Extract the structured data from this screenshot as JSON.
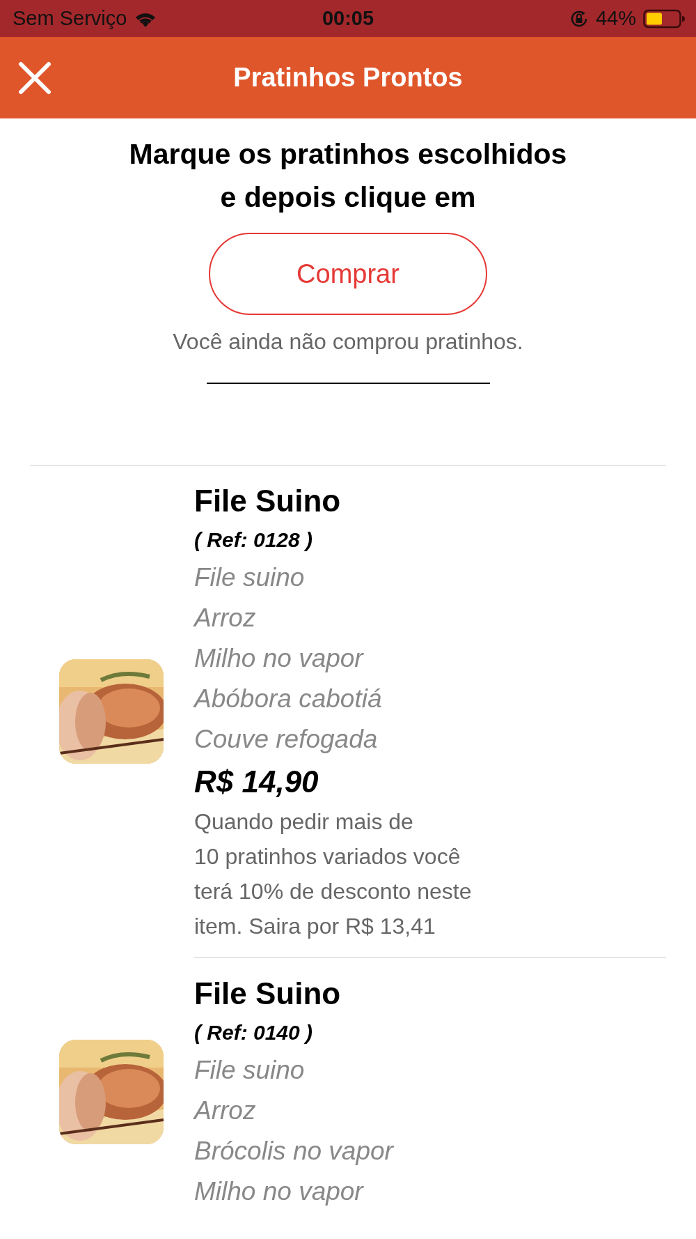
{
  "status_bar": {
    "carrier": "Sem Serviço",
    "time": "00:05",
    "battery": "44%"
  },
  "nav_bar": {
    "title": "Pratinhos Prontos"
  },
  "intro": {
    "heading": [
      "Marque os pratinhos escolhidos",
      "e depois clique em"
    ],
    "button": "Comprar",
    "message": "Você ainda não comprou pratinhos."
  },
  "products": [
    {
      "name": "File Suino",
      "ref": "( Ref: 0128 )",
      "items": [
        "File suino",
        "Arroz",
        "Milho no vapor",
        "Abóbora cabotiá",
        "Couve refogada"
      ],
      "price": "R$ 14,90",
      "note": [
        "Quando pedir mais de",
        "10 pratinhos variados você",
        "terá 10% de desconto neste",
        "item. Saira por R$ 13,41"
      ],
      "image": {
        "kind": "picture"
      }
    },
    {
      "name": "File Suino",
      "ref": "( Ref: 0140 )",
      "items": [
        "File suino",
        "Arroz",
        "Brócolis no vapor",
        "Milho no vapor"
      ],
      "image": {
        "kind": "picture"
      }
    }
  ]
}
